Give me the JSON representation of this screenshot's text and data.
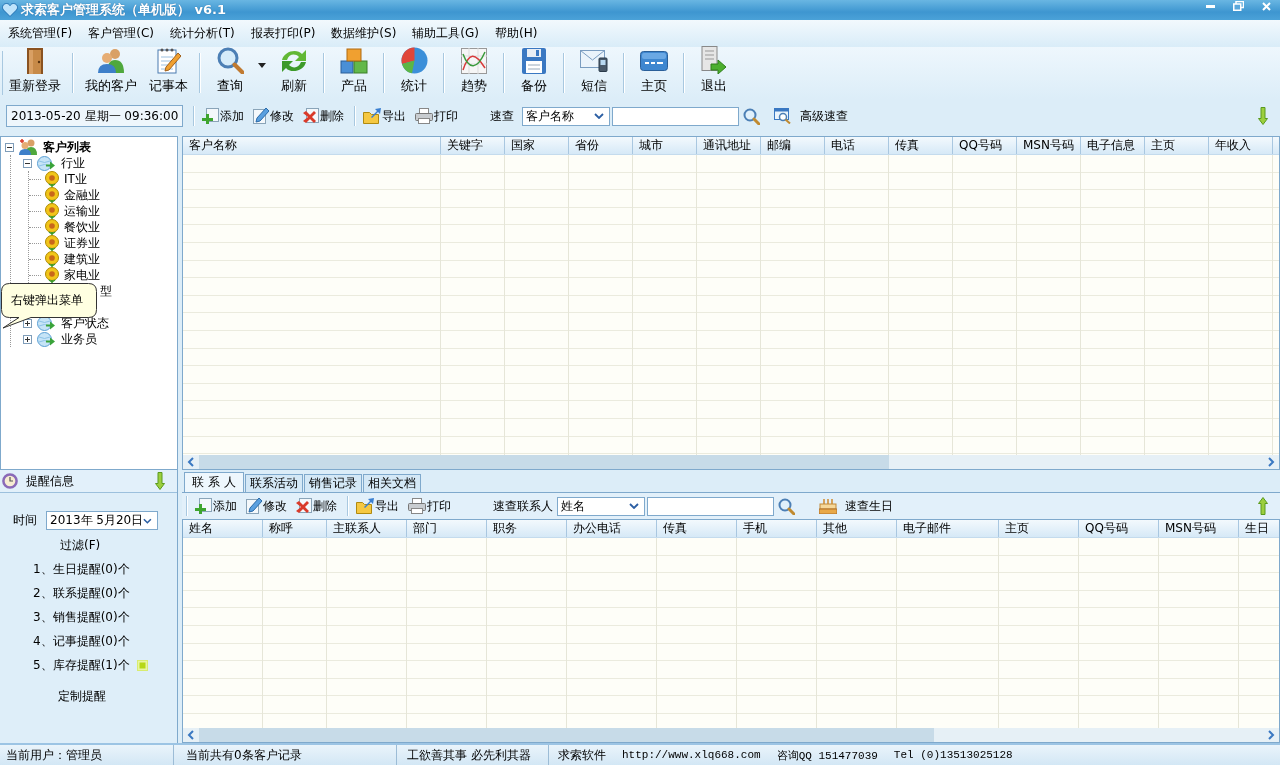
{
  "window": {
    "title": "求索客户管理系统（单机版） v6.1"
  },
  "menu": [
    "系统管理(F)",
    "客户管理(C)",
    "统计分析(T)",
    "报表打印(P)",
    "数据维护(S)",
    "辅助工具(G)",
    "帮助(H)"
  ],
  "toolbar": {
    "groups": [
      [
        {
          "label": "重新登录",
          "dropdown": false
        }
      ],
      [
        {
          "label": "我的客户",
          "dropdown": false
        },
        {
          "label": "记事本",
          "dropdown": false
        }
      ],
      [
        {
          "label": "查询",
          "dropdown": true
        },
        {
          "label": "刷新",
          "dropdown": false
        }
      ],
      [
        {
          "label": "产品",
          "dropdown": false
        }
      ],
      [
        {
          "label": "统计",
          "dropdown": false
        }
      ],
      [
        {
          "label": "趋势",
          "dropdown": false
        }
      ],
      [
        {
          "label": "备份",
          "dropdown": false
        }
      ],
      [
        {
          "label": "短信",
          "dropdown": false
        }
      ],
      [
        {
          "label": "主页",
          "dropdown": false
        }
      ],
      [
        {
          "label": "退出",
          "dropdown": false
        }
      ]
    ]
  },
  "action_bar": {
    "datetime": "2013-05-20 星期一 09:36:00",
    "groups": [
      [
        "添加",
        "修改",
        "删除"
      ],
      [
        "导出",
        "打印"
      ]
    ],
    "search_label": "速查",
    "search_field": "客户名称",
    "advanced_search": "高级速查"
  },
  "customer_tree": {
    "root": {
      "label": "客户列表",
      "expanded": true,
      "children": [
        {
          "label": "行业",
          "kind": "group",
          "expanded": true,
          "children": [
            {
              "label": "IT业"
            },
            {
              "label": "金融业"
            },
            {
              "label": "运输业"
            },
            {
              "label": "餐饮业"
            },
            {
              "label": "证券业"
            },
            {
              "label": "建筑业"
            },
            {
              "label": "家电业"
            }
          ]
        },
        {
          "label": "型",
          "kind": "covered"
        },
        {
          "label": "客户状态",
          "kind": "group",
          "expanded": false
        },
        {
          "label": "业务员",
          "kind": "group",
          "expanded": false
        }
      ]
    }
  },
  "tooltip": {
    "text": "右键弹出菜单"
  },
  "customer_table": {
    "columns": [
      "客户名称",
      "关键字",
      "国家",
      "省份",
      "城市",
      "通讯地址",
      "邮编",
      "电话",
      "传真",
      "QQ号码",
      "MSN号码",
      "电子信息",
      "主页",
      "年收入"
    ]
  },
  "reminders": {
    "title": "提醒信息",
    "time_label": "时间",
    "date": "2013年 5月20日",
    "filter": "过滤(F)",
    "items": [
      {
        "text": "1、生日提醒(0)个",
        "flagged": false
      },
      {
        "text": "2、联系提醒(0)个",
        "flagged": false
      },
      {
        "text": "3、销售提醒(0)个",
        "flagged": false
      },
      {
        "text": "4、记事提醒(0)个",
        "flagged": false
      },
      {
        "text": "5、库存提醒(1)个",
        "flagged": true
      }
    ],
    "custom": "定制提醒"
  },
  "detail_tabs": [
    {
      "label": "联 系 人",
      "selected": true
    },
    {
      "label": "联系活动",
      "selected": false
    },
    {
      "label": "销售记录",
      "selected": false
    },
    {
      "label": "相关文档",
      "selected": false
    }
  ],
  "contact_bar": {
    "groups": [
      [
        "添加",
        "修改",
        "删除"
      ],
      [
        "导出",
        "打印"
      ]
    ],
    "search_label": "速查联系人",
    "search_field": "姓名",
    "birthday_search": "速查生日"
  },
  "contact_table": {
    "columns": [
      "姓名",
      "称呼",
      "主联系人",
      "部门",
      "职务",
      "办公电话",
      "传真",
      "手机",
      "其他",
      "电子邮件",
      "主页",
      "QQ号码",
      "MSN号码",
      "生日"
    ]
  },
  "status_bar": {
    "sections": [
      [
        "当前用户：管理员"
      ],
      [
        "当前共有0条客户记录"
      ],
      [
        "工欲善其事 必先利其器"
      ],
      [
        "求索软件",
        "http://www.xlq668.com",
        "咨询QQ 151477039",
        "Tel (0)13513025128"
      ]
    ]
  }
}
